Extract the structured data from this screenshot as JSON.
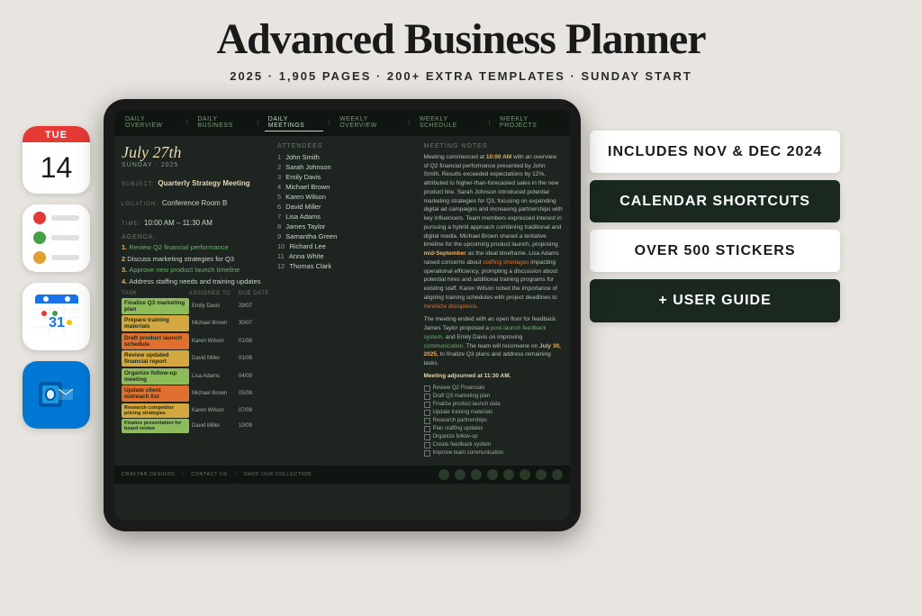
{
  "header": {
    "main_title": "Advanced Business Planner",
    "subtitle": "2025  ·  1,905 PAGES  ·  200+ EXTRA TEMPLATES  ·  SUNDAY START"
  },
  "left_icons": [
    {
      "id": "calendar",
      "type": "calendar",
      "day_label": "TUE",
      "day_number": "14"
    },
    {
      "id": "reminders",
      "type": "reminders"
    },
    {
      "id": "gcal",
      "type": "gcal"
    },
    {
      "id": "outlook",
      "type": "outlook"
    }
  ],
  "tablet": {
    "nav_items": [
      "DAILY OVERVIEW",
      "DAILY BUSINESS",
      "DAILY MEETINGS",
      "WEEKLY OVERVIEW",
      "WEEKLY SCHEDULE",
      "WEEKLY PROJECTS"
    ],
    "active_nav": "DAILY MEETINGS",
    "date": "July 27th",
    "date_sub": "SUNDAY · 2025",
    "subject_label": "SUBJECT:",
    "subject_value": "Quarterly Strategy Meeting",
    "location_label": "LOCATION:",
    "location_value": "Conference Room B",
    "time_label": "TIME:",
    "time_value": "10:00 AM – 11:30 AM",
    "agenda_title": "AGENDA:",
    "agenda_items": [
      {
        "num": "1",
        "text": "Review Q2 financial performance",
        "highlight": true
      },
      {
        "num": "2",
        "text": "Discuss marketing strategies for Q3"
      },
      {
        "num": "3",
        "text": "Approve new product launch timeline",
        "highlight": true
      },
      {
        "num": "4",
        "text": "Address staffing needs and training updates"
      }
    ],
    "task_headers": [
      "TASK",
      "ASSIGNED TO",
      "DUE DATE"
    ],
    "tasks": [
      {
        "name": "Finalize Q3 marketing plan",
        "color": "green",
        "person": "Emily Davis",
        "date": "29/07"
      },
      {
        "name": "Prepare training materials",
        "color": "yellow",
        "person": "Michael Brown",
        "date": "30/07"
      },
      {
        "name": "Draft product launch schedule",
        "color": "orange",
        "person": "Karen Wilson",
        "date": "01/08"
      },
      {
        "name": "Review updated financial report",
        "color": "yellow",
        "person": "David Miller",
        "date": "01/08"
      },
      {
        "name": "Organize follow-up meeting",
        "color": "green",
        "person": "Lisa Adams",
        "date": "04/09"
      },
      {
        "name": "Update client outreach list",
        "color": "orange",
        "person": "Michael Brown",
        "date": "05/09"
      },
      {
        "name": "Research competitor pricing strategies",
        "color": "yellow",
        "person": "Karen Wilson",
        "date": "07/09"
      },
      {
        "name": "Finalize presentation for board review",
        "color": "green",
        "person": "David Miller",
        "date": "10/09"
      }
    ],
    "attendees_title": "ATTENDEES",
    "attendees": [
      {
        "num": "1",
        "name": "John Smith"
      },
      {
        "num": "2",
        "name": "Sarah Johnson"
      },
      {
        "num": "3",
        "name": "Emily Davis"
      },
      {
        "num": "4",
        "name": "Michael Brown"
      },
      {
        "num": "5",
        "name": "Karen Wilson"
      },
      {
        "num": "6",
        "name": "David Miller"
      },
      {
        "num": "7",
        "name": "Lisa Adams"
      },
      {
        "num": "8",
        "name": "James Taylor"
      },
      {
        "num": "9",
        "name": "Samantha Green"
      },
      {
        "num": "10",
        "name": "Richard Lee"
      },
      {
        "num": "11",
        "name": "Anna White"
      },
      {
        "num": "12",
        "name": "Thomas Clark"
      }
    ],
    "notes_title": "MEETING NOTES",
    "notes_paragraphs": [
      "Meeting commenced at 10:00 AM with an overview of Q2 financial performance presented by John Smith. Results exceeded expectations by 12%, attributed to higher-than-forecasted sales in the new product line. Sarah Johnson introduced potential marketing strategies for Q3, focusing on expanding digital ad campaigns and increasing partnerships with key influencers. Team members expressed interest in pursuing a hybrid approach combining traditional and digital media. Michael Brown shared a tentative timeline for the upcoming product launch, proposing mid-September as the ideal timeframe. Lisa Adams raised concerns about staffing shortages impacting operational efficiency, prompting a discussion about potential hires and additional training programs for existing staff. Karen Wilson noted the importance of aligning training schedules with project deadlines to minimize disruptions.",
      "The meeting ended with an open floor for feedback. James Taylor proposed a post-launch feedback system, and Emily Davis on improving communication. The team will reconvene on July 30, 2025, to finalize Q3 plans and address remaining tasks.",
      "Meeting adjourned at 11:30 AM."
    ],
    "checklist_items": [
      "Review Q2 Financials",
      "Draft Q3 marketing plan",
      "Finalize product launch data",
      "Update training materials",
      "Research partnerships",
      "Plan staffing updates",
      "Organize follow-up",
      "Create feedback system",
      "Improve team communication"
    ],
    "footer_links": [
      "CRAFTAN DESIGNS",
      "CONTACT US",
      "SHOP OUR COLLECTION"
    ]
  },
  "badges": [
    {
      "id": "nov-dec",
      "text": "INCLUDES NOV & DEC 2024",
      "dark": false
    },
    {
      "id": "calendar-shortcuts",
      "text": "CALENDAR SHORTCUTS",
      "dark": true
    },
    {
      "id": "stickers",
      "text": "OVER 500 STICKERS",
      "dark": false
    },
    {
      "id": "user-guide",
      "text": "+ USER GUIDE",
      "dark": true
    }
  ]
}
